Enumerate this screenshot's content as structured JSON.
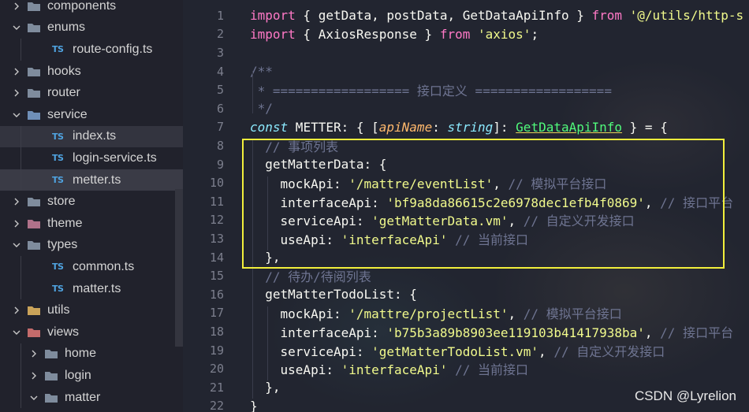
{
  "explorer": {
    "items": [
      {
        "label": "components",
        "type": "folder",
        "expanded": false,
        "depth": 0
      },
      {
        "label": "enums",
        "type": "folder",
        "expanded": true,
        "depth": 0
      },
      {
        "label": "route-config.ts",
        "type": "ts",
        "depth": 1
      },
      {
        "label": "hooks",
        "type": "folder",
        "expanded": false,
        "depth": 0
      },
      {
        "label": "router",
        "type": "folder",
        "expanded": false,
        "depth": 0
      },
      {
        "label": "service",
        "type": "folder",
        "expanded": true,
        "depth": 0
      },
      {
        "label": "index.ts",
        "type": "ts",
        "depth": 1
      },
      {
        "label": "login-service.ts",
        "type": "ts",
        "depth": 1
      },
      {
        "label": "metter.ts",
        "type": "ts",
        "depth": 1
      },
      {
        "label": "store",
        "type": "folder",
        "expanded": false,
        "depth": 0
      },
      {
        "label": "theme",
        "type": "folder",
        "expanded": false,
        "depth": 0
      },
      {
        "label": "types",
        "type": "folder",
        "expanded": true,
        "depth": 0
      },
      {
        "label": "common.ts",
        "type": "ts",
        "depth": 1
      },
      {
        "label": "matter.ts",
        "type": "ts",
        "depth": 1
      },
      {
        "label": "utils",
        "type": "folder",
        "expanded": false,
        "depth": 0
      },
      {
        "label": "views",
        "type": "folder",
        "expanded": true,
        "depth": 0
      },
      {
        "label": "home",
        "type": "folder",
        "expanded": false,
        "depth": 1
      },
      {
        "label": "login",
        "type": "folder",
        "expanded": false,
        "depth": 1
      },
      {
        "label": "matter",
        "type": "folder",
        "expanded": true,
        "depth": 1
      }
    ],
    "ts_badge": "TS"
  },
  "editor": {
    "lines": [
      {
        "n": "1",
        "tokens": [
          [
            "kw",
            "import"
          ],
          [
            "pun",
            " { getData, postData, GetDataApiInfo } "
          ],
          [
            "kw",
            "from"
          ],
          [
            "pun",
            " "
          ],
          [
            "str",
            "'@/utils/http-s"
          ]
        ]
      },
      {
        "n": "2",
        "tokens": [
          [
            "kw",
            "import"
          ],
          [
            "pun",
            " { AxiosResponse } "
          ],
          [
            "kw",
            "from"
          ],
          [
            "pun",
            " "
          ],
          [
            "str",
            "'axios'"
          ],
          [
            "pun",
            ";"
          ]
        ]
      },
      {
        "n": "3",
        "tokens": []
      },
      {
        "n": "4",
        "tokens": [
          [
            "com",
            "/**"
          ]
        ]
      },
      {
        "n": "5",
        "tokens": [
          [
            "com",
            " * ================== 接口定义 =================="
          ]
        ]
      },
      {
        "n": "6",
        "tokens": [
          [
            "com",
            " */"
          ]
        ]
      },
      {
        "n": "7",
        "tokens": [
          [
            "const",
            "const"
          ],
          [
            "pun",
            " METTER: { ["
          ],
          [
            "param",
            "apiName"
          ],
          [
            "pun",
            ": "
          ],
          [
            "typ",
            "string"
          ],
          [
            "pun",
            "]: "
          ],
          [
            "cls ul",
            "GetDataApiInfo"
          ],
          [
            "pun",
            " } = {"
          ]
        ]
      },
      {
        "n": "8",
        "tokens": [
          [
            "com",
            "  // 事项列表"
          ]
        ]
      },
      {
        "n": "9",
        "tokens": [
          [
            "prop",
            "  getMatterData: {"
          ]
        ]
      },
      {
        "n": "10",
        "tokens": [
          [
            "prop",
            "    mockApi: "
          ],
          [
            "str",
            "'/mattre/eventList'"
          ],
          [
            "pun",
            ", "
          ],
          [
            "com",
            "// 模拟平台接口"
          ]
        ]
      },
      {
        "n": "11",
        "tokens": [
          [
            "prop",
            "    interfaceApi: "
          ],
          [
            "str",
            "'bf9a8da86615c2e6978dec1efb4f0869'"
          ],
          [
            "pun",
            ", "
          ],
          [
            "com",
            "// 接口平台"
          ]
        ]
      },
      {
        "n": "12",
        "tokens": [
          [
            "prop",
            "    serviceApi: "
          ],
          [
            "str",
            "'getMatterData.vm'"
          ],
          [
            "pun",
            ", "
          ],
          [
            "com",
            "// 自定义开发接口"
          ]
        ]
      },
      {
        "n": "13",
        "tokens": [
          [
            "prop",
            "    useApi: "
          ],
          [
            "str",
            "'interfaceApi'"
          ],
          [
            "pun",
            " "
          ],
          [
            "com",
            "// 当前接口"
          ]
        ]
      },
      {
        "n": "14",
        "tokens": [
          [
            "pun",
            "  },"
          ]
        ]
      },
      {
        "n": "15",
        "tokens": [
          [
            "com",
            "  // 待办/待阅列表"
          ]
        ]
      },
      {
        "n": "16",
        "tokens": [
          [
            "prop",
            "  getMatterTodoList: {"
          ]
        ]
      },
      {
        "n": "17",
        "tokens": [
          [
            "prop",
            "    mockApi: "
          ],
          [
            "str",
            "'/mattre/projectList'"
          ],
          [
            "pun",
            ", "
          ],
          [
            "com",
            "// 模拟平台接口"
          ]
        ]
      },
      {
        "n": "18",
        "tokens": [
          [
            "prop",
            "    interfaceApi: "
          ],
          [
            "str",
            "'b75b3a89b8903ee119103b41417938ba'"
          ],
          [
            "pun",
            ", "
          ],
          [
            "com",
            "// 接口平台"
          ]
        ]
      },
      {
        "n": "19",
        "tokens": [
          [
            "prop",
            "    serviceApi: "
          ],
          [
            "str",
            "'getMatterTodoList.vm'"
          ],
          [
            "pun",
            ", "
          ],
          [
            "com",
            "// 自定义开发接口"
          ]
        ]
      },
      {
        "n": "20",
        "tokens": [
          [
            "prop",
            "    useApi: "
          ],
          [
            "str",
            "'interfaceApi'"
          ],
          [
            "pun",
            " "
          ],
          [
            "com",
            "// 当前接口"
          ]
        ]
      },
      {
        "n": "21",
        "tokens": [
          [
            "pun",
            "  },"
          ]
        ]
      },
      {
        "n": "22",
        "tokens": [
          [
            "pun",
            "}"
          ]
        ]
      }
    ]
  },
  "watermark": "CSDN @Lyrelion",
  "colors": {
    "highlight_box": "#f2ef3b",
    "folder": "#7f8c9d",
    "ts": "#4fa3e0"
  }
}
